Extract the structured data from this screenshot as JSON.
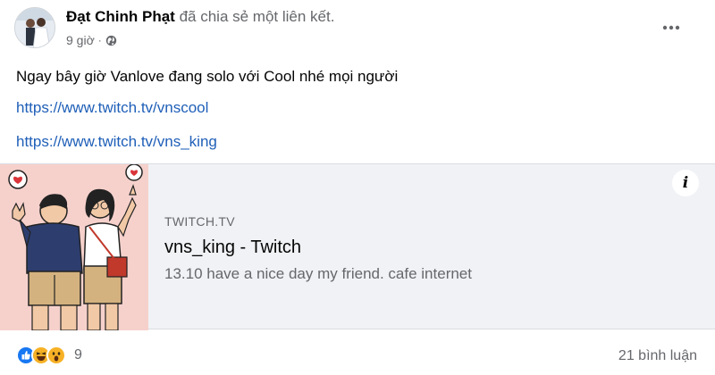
{
  "post": {
    "author": "Đạt Chinh Phạt",
    "action": "đã chia sẻ một liên kết.",
    "time": "9 giờ",
    "separator": "·",
    "audience_icon": "globe-icon",
    "text": "Ngay bây giờ Vanlove đang solo với Cool nhé mọi người",
    "links": [
      "https://www.twitch.tv/vnscool",
      "https://www.twitch.tv/vns_king"
    ]
  },
  "preview": {
    "domain": "TWITCH.TV",
    "title": "vns_king - Twitch",
    "description": "13.10 have a nice day my friend. cafe internet",
    "info_glyph": "i"
  },
  "footer": {
    "reaction_icons": [
      "like-icon",
      "haha-icon",
      "wow-icon"
    ],
    "reaction_count": "9",
    "comments": "21 bình luận"
  },
  "colors": {
    "link": "#1f5fb8",
    "preview_bg": "#f0f2f5",
    "thumb_bg": "#f6d1cc",
    "like": "#1877f2",
    "emoji": "#f7b125"
  }
}
